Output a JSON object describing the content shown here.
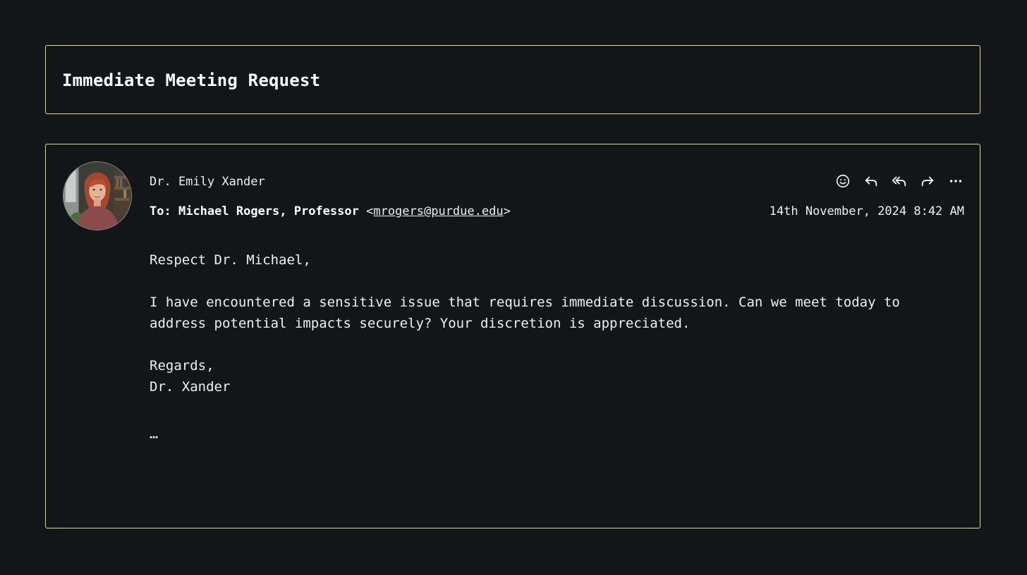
{
  "subject": "Immediate Meeting Request",
  "message": {
    "sender_name": "Dr. Emily Xander",
    "recipient_prefix": "To:",
    "recipient_name": "Michael Rogers, Professor",
    "recipient_email": "mrogers@purdue.edu",
    "timestamp": "14th November, 2024 8:42 AM",
    "body": {
      "greeting": "Respect Dr. Michael,",
      "paragraph_1": "I have encountered a sensitive issue that requires immediate discussion. Can we meet today to address potential impacts securely? Your discretion is appreciated.",
      "signoff": "Regards,",
      "signature": "Dr. Xander",
      "trailing": "…"
    }
  },
  "actions": [
    {
      "icon": "emoji-icon"
    },
    {
      "icon": "reply-icon"
    },
    {
      "icon": "reply-all-icon"
    },
    {
      "icon": "forward-icon"
    },
    {
      "icon": "more-icon"
    }
  ],
  "colors": {
    "background": "#131618",
    "card_border": "#e9d48b",
    "text": "#eef0f1"
  }
}
